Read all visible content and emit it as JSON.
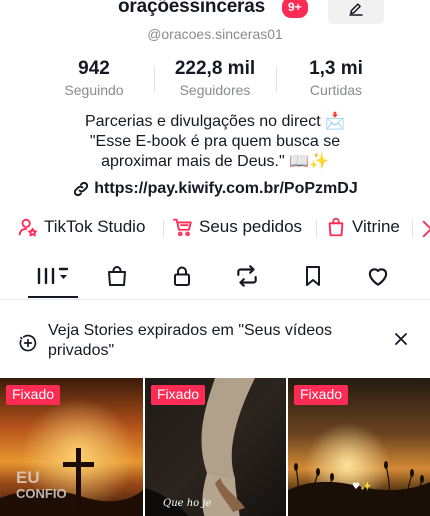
{
  "profile": {
    "username": "oraçõessinceras",
    "notification_badge": "9+",
    "handle": "@oracoes.sinceras01"
  },
  "stats": [
    {
      "value": "942",
      "label": "Seguindo"
    },
    {
      "value": "222,8 mil",
      "label": "Seguidores"
    },
    {
      "value": "1,3 mi",
      "label": "Curtidas"
    }
  ],
  "bio": {
    "line1": "Parcerias e divulgações no direct 📩",
    "line2": "\"Esse E-book é pra quem busca se",
    "line3": "aproximar mais de Deus.\" 📖✨"
  },
  "link": {
    "url": "https://pay.kiwify.com.br/PoPzmDJ",
    "icon": "link-icon"
  },
  "shortcuts": [
    {
      "label": "TikTok Studio",
      "icon": "creator-studio-icon"
    },
    {
      "label": "Seus pedidos",
      "icon": "shopping-cart-icon"
    },
    {
      "label": "Vitrine",
      "icon": "shopping-bag-icon"
    }
  ],
  "tabs": [
    {
      "icon": "videos-grid-icon",
      "active": true
    },
    {
      "icon": "shop-bag-icon"
    },
    {
      "icon": "lock-icon"
    },
    {
      "icon": "repost-icon"
    },
    {
      "icon": "bookmark-icon"
    },
    {
      "icon": "heart-icon"
    }
  ],
  "stories_banner": {
    "text": "Veja Stories expirados em \"Seus vídeos privados\""
  },
  "videos": [
    {
      "pin_label": "Fixado",
      "overlay_text_1": "EU",
      "overlay_text_2": "CONFIO"
    },
    {
      "pin_label": "Fixado",
      "caption": "Que ho je"
    },
    {
      "pin_label": "Fixado",
      "caption": "♥✨"
    }
  ],
  "colors": {
    "accent": "#fe2c55",
    "text": "#161823",
    "muted": "#8a8b91"
  }
}
